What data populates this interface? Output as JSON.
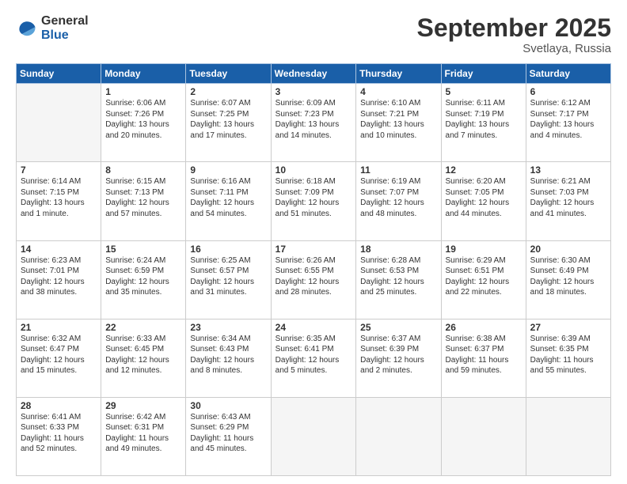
{
  "header": {
    "logo_general": "General",
    "logo_blue": "Blue",
    "title": "September 2025",
    "location": "Svetlaya, Russia"
  },
  "weekdays": [
    "Sunday",
    "Monday",
    "Tuesday",
    "Wednesday",
    "Thursday",
    "Friday",
    "Saturday"
  ],
  "weeks": [
    [
      {
        "day": null
      },
      {
        "day": "1",
        "sunrise": "6:06 AM",
        "sunset": "7:26 PM",
        "daylight": "13 hours and 20 minutes."
      },
      {
        "day": "2",
        "sunrise": "6:07 AM",
        "sunset": "7:25 PM",
        "daylight": "13 hours and 17 minutes."
      },
      {
        "day": "3",
        "sunrise": "6:09 AM",
        "sunset": "7:23 PM",
        "daylight": "13 hours and 14 minutes."
      },
      {
        "day": "4",
        "sunrise": "6:10 AM",
        "sunset": "7:21 PM",
        "daylight": "13 hours and 10 minutes."
      },
      {
        "day": "5",
        "sunrise": "6:11 AM",
        "sunset": "7:19 PM",
        "daylight": "13 hours and 7 minutes."
      },
      {
        "day": "6",
        "sunrise": "6:12 AM",
        "sunset": "7:17 PM",
        "daylight": "13 hours and 4 minutes."
      }
    ],
    [
      {
        "day": "7",
        "sunrise": "6:14 AM",
        "sunset": "7:15 PM",
        "daylight": "13 hours and 1 minute."
      },
      {
        "day": "8",
        "sunrise": "6:15 AM",
        "sunset": "7:13 PM",
        "daylight": "12 hours and 57 minutes."
      },
      {
        "day": "9",
        "sunrise": "6:16 AM",
        "sunset": "7:11 PM",
        "daylight": "12 hours and 54 minutes."
      },
      {
        "day": "10",
        "sunrise": "6:18 AM",
        "sunset": "7:09 PM",
        "daylight": "12 hours and 51 minutes."
      },
      {
        "day": "11",
        "sunrise": "6:19 AM",
        "sunset": "7:07 PM",
        "daylight": "12 hours and 48 minutes."
      },
      {
        "day": "12",
        "sunrise": "6:20 AM",
        "sunset": "7:05 PM",
        "daylight": "12 hours and 44 minutes."
      },
      {
        "day": "13",
        "sunrise": "6:21 AM",
        "sunset": "7:03 PM",
        "daylight": "12 hours and 41 minutes."
      }
    ],
    [
      {
        "day": "14",
        "sunrise": "6:23 AM",
        "sunset": "7:01 PM",
        "daylight": "12 hours and 38 minutes."
      },
      {
        "day": "15",
        "sunrise": "6:24 AM",
        "sunset": "6:59 PM",
        "daylight": "12 hours and 35 minutes."
      },
      {
        "day": "16",
        "sunrise": "6:25 AM",
        "sunset": "6:57 PM",
        "daylight": "12 hours and 31 minutes."
      },
      {
        "day": "17",
        "sunrise": "6:26 AM",
        "sunset": "6:55 PM",
        "daylight": "12 hours and 28 minutes."
      },
      {
        "day": "18",
        "sunrise": "6:28 AM",
        "sunset": "6:53 PM",
        "daylight": "12 hours and 25 minutes."
      },
      {
        "day": "19",
        "sunrise": "6:29 AM",
        "sunset": "6:51 PM",
        "daylight": "12 hours and 22 minutes."
      },
      {
        "day": "20",
        "sunrise": "6:30 AM",
        "sunset": "6:49 PM",
        "daylight": "12 hours and 18 minutes."
      }
    ],
    [
      {
        "day": "21",
        "sunrise": "6:32 AM",
        "sunset": "6:47 PM",
        "daylight": "12 hours and 15 minutes."
      },
      {
        "day": "22",
        "sunrise": "6:33 AM",
        "sunset": "6:45 PM",
        "daylight": "12 hours and 12 minutes."
      },
      {
        "day": "23",
        "sunrise": "6:34 AM",
        "sunset": "6:43 PM",
        "daylight": "12 hours and 8 minutes."
      },
      {
        "day": "24",
        "sunrise": "6:35 AM",
        "sunset": "6:41 PM",
        "daylight": "12 hours and 5 minutes."
      },
      {
        "day": "25",
        "sunrise": "6:37 AM",
        "sunset": "6:39 PM",
        "daylight": "12 hours and 2 minutes."
      },
      {
        "day": "26",
        "sunrise": "6:38 AM",
        "sunset": "6:37 PM",
        "daylight": "11 hours and 59 minutes."
      },
      {
        "day": "27",
        "sunrise": "6:39 AM",
        "sunset": "6:35 PM",
        "daylight": "11 hours and 55 minutes."
      }
    ],
    [
      {
        "day": "28",
        "sunrise": "6:41 AM",
        "sunset": "6:33 PM",
        "daylight": "11 hours and 52 minutes."
      },
      {
        "day": "29",
        "sunrise": "6:42 AM",
        "sunset": "6:31 PM",
        "daylight": "11 hours and 49 minutes."
      },
      {
        "day": "30",
        "sunrise": "6:43 AM",
        "sunset": "6:29 PM",
        "daylight": "11 hours and 45 minutes."
      },
      {
        "day": null
      },
      {
        "day": null
      },
      {
        "day": null
      },
      {
        "day": null
      }
    ]
  ],
  "labels": {
    "sunrise_prefix": "Sunrise: ",
    "sunset_prefix": "Sunset: ",
    "daylight_prefix": "Daylight: "
  }
}
